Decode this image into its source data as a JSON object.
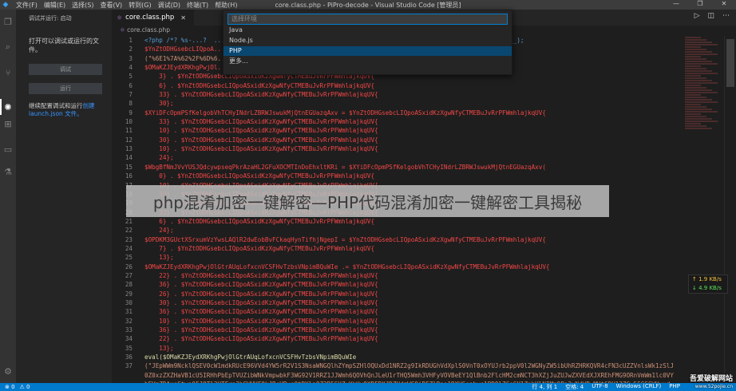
{
  "titlebar": {
    "menu": [
      "文件(F)",
      "编辑(E)",
      "选择(S)",
      "查看(V)",
      "转到(G)",
      "调试(D)",
      "终端(T)",
      "帮助(H)"
    ],
    "title": "core.class.php - PiPro-decode - Visual Studio Code [管理员]",
    "controls": [
      "—",
      "❐",
      "✕"
    ]
  },
  "sidebar": {
    "title": "调试并运行: 启动",
    "description": "打开可以调试或运行的文件。",
    "debug_button": "调试",
    "run_button": "运行",
    "note_prefix": "继续配置调试和运行",
    "note_link": "创建 launch.json 文件。"
  },
  "editor": {
    "tab_label": "core.class.php",
    "breadcrumb": "core.class.php"
  },
  "quickpick": {
    "placeholder": "选择环境",
    "items": [
      "Java",
      "Node.js",
      "PHP",
      "更多..."
    ],
    "selected_index": 2
  },
  "code_lines": [
    {
      "n": "1",
      "t": "<?php /*? %s-...?  ...  ...  ...  ...  ...  ...  ...  ...  ...  ...  ...  ...  ...  ...  ...  ...ILE__);"
    },
    {
      "n": "2",
      "t": "$YnZtODHGsebcLIQpoA..."
    },
    {
      "n": "3",
      "t": "(\"%6E1%7A%62%2F%6D%6...                                                   ...%6637%6A\");"
    },
    {
      "n": "4",
      "t": "$OMaKZJEydXRKhgPwjOl..                                                    ...WmhlajkqUV{"
    },
    {
      "n": "5",
      "t": "    3} . $YnZtODHGsebcLIQpoASxidKzXgwNfyCTMEBuJvRrPFWmhlajkqUV{"
    },
    {
      "n": "6",
      "t": "    6} . $YnZtODHGsebcLIQpoASxidKzXgwNfyCTMEBuJvRrPFWmhlajkqUV{"
    },
    {
      "n": "7",
      "t": "    33} . $YnZtODHGsebcLIQpoASxidKzXgwNfyCTMEBuJvRrPFWmhlajkqUV{"
    },
    {
      "n": "8",
      "t": "    30};"
    },
    {
      "n": "9",
      "t": "$XYiDFcOpmPSfKelgobVhTCHyINdrLZBRWJswukMjQtnEGUazqAxv = $YnZtODHGsebcLIQpoASxidKzXgwNfyCTMEBuJvRrPFWmhlajkqUV{"
    },
    {
      "n": "10",
      "t": "    33} . $YnZtODHGsebcLIQpoASxidKzXgwNfyCTMEBuJvRrPFWmhlajkqUV{"
    },
    {
      "n": "11",
      "t": "    10} . $YnZtODHGsebcLIQpoASxidKzXgwNfyCTMEBuJvRrPFWmhlajkqUV{"
    },
    {
      "n": "12",
      "t": "    30} . $YnZtODHGsebcLIQpoASxidKzXgwNfyCTMEBuJvRrPFWmhlajkqUV{"
    },
    {
      "n": "13",
      "t": "    10} . $YnZtODHGsebcLIQpoASxidKzXgwNfyCTMEBuJvRrPFWmhlajkqUV{"
    },
    {
      "n": "14",
      "t": "    24};"
    },
    {
      "n": "15",
      "t": "$WbgBfNmJVvYUSJQdcywpseqPkrAzaHL2GFuXOCMTInDoEhxltKRi = $XYiDFcOpmPSfKelgobVhTCHyINdrLZBRWJswukMjQtnEGUazqAxv("
    },
    {
      "n": "16",
      "t": "    0} . $YnZtODHGsebcLIQpoASxidKzXgwNfyCTMEBuJvRrPFWmhlajkqUV{"
    },
    {
      "n": "17",
      "t": "    10} . $YnZtODHGsebcLIQpoASxidKzXgwNfyCTMEBuJvRrPFWmhlajkqUV{"
    },
    {
      "n": "18",
      "t": "    33} . $YnZtODHGsebcLIQpoASxidKzXgwNfyCTMEBuJvRrPFWmhlajkqUV{"
    },
    {
      "n": "19",
      "t": "    10} . $YnZtODHGsebcLIQpoASxidKzXgwNfyCTMEBuJvRrPFWmhlajkqUV{"
    },
    {
      "n": "20",
      "t": "    33} . $YnZtODHGsebcLIQpoASxidKzXgwNfyCTMEBuJvRrPFWmhlajkqUV{"
    },
    {
      "n": "21",
      "t": "    6} . $YnZtODHGsebcLIQpoASxidKzXgwNfyCTMEBuJvRrPFWmhlajkqUV{"
    },
    {
      "n": "22",
      "t": "    24};"
    },
    {
      "n": "23",
      "t": "$OPDKM3GUctXSrxumVzYwsLAQlR2dwEobBvFCkaqHynTifhjNgepI = $YnZtODHGsebcLIQpoASxidKzXgwNfyCTMEBuJvRrPFWmhlajkqUV{"
    },
    {
      "n": "24",
      "t": "    7} . $YnZtODHGsebcLIQpoASxidKzXgwNfyCTMEBuJvRrPFWmhlajkqUV{"
    },
    {
      "n": "25",
      "t": "    13};"
    },
    {
      "n": "26",
      "t": "$OMaKZJEydXRKhgPwjOlGtrAUqLofxcnVCSFHvTzbsVNpimBQuWIe .= $YnZtODHGsebcLIQpoASxidKzXgwNfyCTMEBuJvRrPFWmhlajkqUV{"
    },
    {
      "n": "27",
      "t": "    22} . $YnZtODHGsebcLIQpoASxidKzXgwNfyCTMEBuJvRrPFWmhlajkqUV{"
    },
    {
      "n": "28",
      "t": "    36} . $YnZtODHGsebcLIQpoASxidKzXgwNfyCTMEBuJvRrPFWmhlajkqUV{"
    },
    {
      "n": "29",
      "t": "    26} . $YnZtODHGsebcLIQpoASxidKzXgwNfyCTMEBuJvRrPFWmhlajkqUV{"
    },
    {
      "n": "30",
      "t": "    30} . $YnZtODHGsebcLIQpoASxidKzXgwNfyCTMEBuJvRrPFWmhlajkqUV{"
    },
    {
      "n": "31",
      "t": "    36} . $YnZtODHGsebcLIQpoASxidKzXgwNfyCTMEBuJvRrPFWmhlajkqUV{"
    },
    {
      "n": "32",
      "t": "    10} . $YnZtODHGsebcLIQpoASxidKzXgwNfyCTMEBuJvRrPFWmhlajkqUV{"
    },
    {
      "n": "33",
      "t": "    36} . $YnZtODHGsebcLIQpoASxidKzXgwNfyCTMEBuJvRrPFWmhlajkqUV{"
    },
    {
      "n": "34",
      "t": "    22} . $YnZtODHGsebcLIQpoASxidKzXgwNfyCTMEBuJvRrPFWmhlajkqUV{"
    },
    {
      "n": "35",
      "t": "    13};"
    },
    {
      "n": "36",
      "t": "eval($OMaKZJEydXRKhgPwjOlGtrAUqLofxcnVCSFHvTzbsVNpimBQuWIe"
    },
    {
      "n": "37",
      "t": "(\"JEpWWm9NcklQSEV0cW1mdkRUcE96VVd4YW5rR2V1S3NsaWNGQlhZYmpSZHlOQUxDd1NRZ2g9IkRDUGhVdXplS0VnT0xOYUJrb2ppV0l2WGNyZW5ibUhRZHRKQVR4cFN3cUZZVnlsWk1zSlJ"
    },
    {
      "n": "",
      "t": "0Z0xzZXZHaVB1cU5IRHhPbEpTVUZibWNkVmpwbkF3WG92V1RRZ1JJWmh6QOVhQnJLeU1rTHQ5Wmh3VHFyVOVBeEY1QlBnb2FlcHM2cmNCT3hXZjJuZUJwZXVEdXJXREhFMG9ORnVmWm1lc0VY"
    },
    {
      "n": "",
      "t": "bEVmZDAxeGtwa0FJOTl2UTFra3hGWVVFOkJReHBvc0tRYlpOZ2R5SUZvYkUvOXRFRXJDZHdzWG9iRFZlRno1RXVSenhwc1BDOlZCeGU1ZnhUlNIMm9Pa2xNdWBwMUtGRU13ZGw5SGSGWUxud"
    }
  ],
  "banner_text": "php混淆加密一键解密—PHP代码混淆加密一键解密工具揭秘",
  "netspeed": {
    "up": "1.9 KB/s",
    "down": "4.9 KB/s"
  },
  "statusbar": {
    "left": [
      "⊗ 0",
      "⚠ 0"
    ],
    "right": [
      "行 4, 列 1",
      "空格: 4",
      "UTF-8",
      "Windows (CRLF)",
      "PHP"
    ]
  },
  "watermark": {
    "main": "吾爱破解网站",
    "sub": "www.52pojie.cn"
  }
}
